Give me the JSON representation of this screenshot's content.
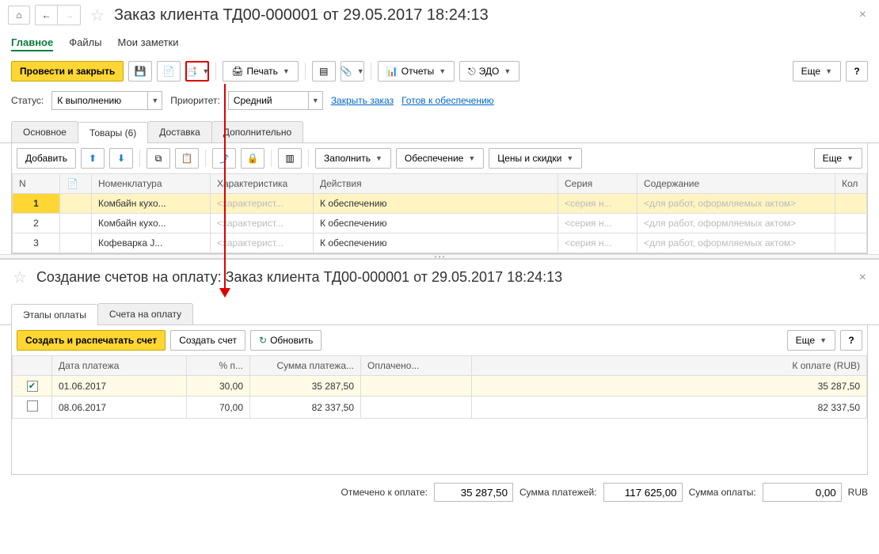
{
  "top": {
    "title": "Заказ клиента ТД00-000001 от 29.05.2017 18:24:13",
    "tabs": [
      "Главное",
      "Файлы",
      "Мои заметки"
    ],
    "active_tab": 0
  },
  "toolbar": {
    "post_close": "Провести и закрыть",
    "print": "Печать",
    "reports": "Отчеты",
    "edo": "ЭДО",
    "more": "Еще"
  },
  "status": {
    "status_label": "Статус:",
    "status_value": "К выполнению",
    "priority_label": "Приоритет:",
    "priority_value": "Средний",
    "close_order": "Закрыть заказ",
    "ready_supply": "Готов к обеспечению"
  },
  "subtabs": [
    "Основное",
    "Товары (6)",
    "Доставка",
    "Дополнительно"
  ],
  "subtab_active": 1,
  "items_toolbar": {
    "add": "Добавить",
    "fill": "Заполнить",
    "supply": "Обеспечение",
    "prices": "Цены и скидки",
    "more": "Еще"
  },
  "items_table": {
    "headers": [
      "N",
      "",
      "Номенклатура",
      "Характеристика",
      "Действия",
      "Серия",
      "Содержание",
      "Кол"
    ],
    "rows": [
      {
        "n": "1",
        "nom": "Комбайн кухо...",
        "char": "<характерист...",
        "act": "К обеспечению",
        "ser": "<серия н...",
        "cont": "<для работ, оформляемых актом>",
        "selected": true
      },
      {
        "n": "2",
        "nom": "Комбайн кухо...",
        "char": "<характерист...",
        "act": "К обеспечению",
        "ser": "<серия н...",
        "cont": "<для работ, оформляемых актом>"
      },
      {
        "n": "3",
        "nom": "Кофеварка J...",
        "char": "<характерист...",
        "act": "К обеспечению",
        "ser": "<серия н...",
        "cont": "<для работ, оформляемых актом>"
      }
    ]
  },
  "bottom": {
    "title": "Создание счетов на оплату: Заказ клиента ТД00-000001 от 29.05.2017 18:24:13",
    "tabs": [
      "Этапы оплаты",
      "Счета на оплату"
    ],
    "active_tab": 0,
    "create_print": "Создать и распечатать счет",
    "create": "Создать счет",
    "refresh": "Обновить",
    "more": "Еще"
  },
  "pay_table": {
    "headers": [
      "",
      "Дата платежа",
      "% п...",
      "Сумма платежа...",
      "Оплачено...",
      "К оплате (RUB)"
    ],
    "rows": [
      {
        "checked": true,
        "date": "01.06.2017",
        "pct": "30,00",
        "sum": "35 287,50",
        "paid": "",
        "due": "35 287,50"
      },
      {
        "checked": false,
        "date": "08.06.2017",
        "pct": "70,00",
        "sum": "82 337,50",
        "paid": "",
        "due": "82 337,50"
      }
    ]
  },
  "footer": {
    "marked_label": "Отмечено к оплате:",
    "marked_value": "35 287,50",
    "sum_label": "Сумма платежей:",
    "sum_value": "117 625,00",
    "pay_label": "Сумма оплаты:",
    "pay_value": "0,00",
    "currency": "RUB"
  }
}
